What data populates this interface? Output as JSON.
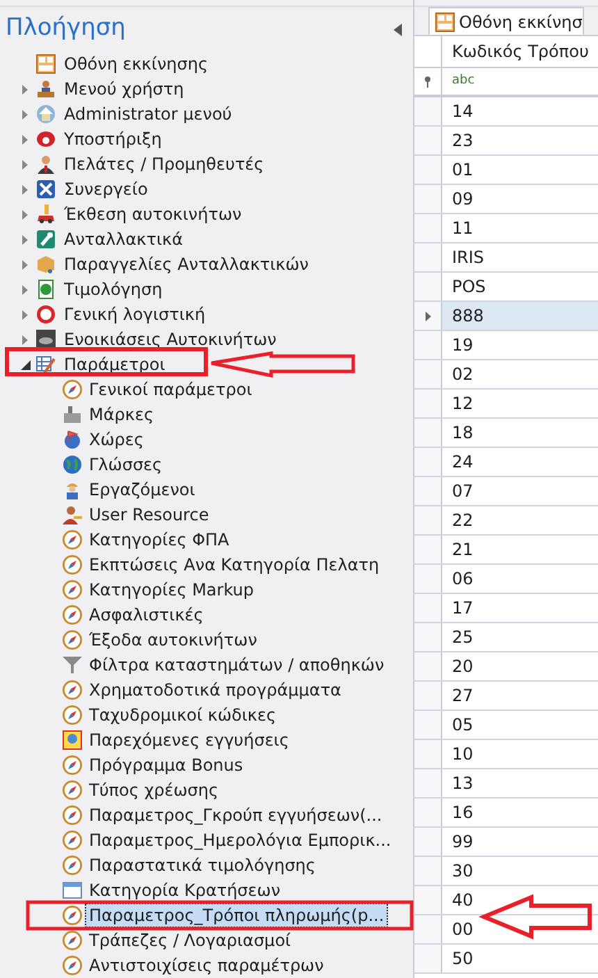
{
  "navigation": {
    "title": "Πλοήγηση",
    "items": [
      {
        "label": "Οθόνη εκκίνησης",
        "expandable": false,
        "selected": false
      },
      {
        "label": "Μενού χρήστη",
        "expandable": true,
        "expanded": false,
        "selected": false
      },
      {
        "label": "Administrator μενού",
        "expandable": true,
        "expanded": false,
        "selected": false
      },
      {
        "label": "Υποστήριξη",
        "expandable": true,
        "expanded": false,
        "selected": false
      },
      {
        "label": "Πελάτες / Προμηθευτές",
        "expandable": true,
        "expanded": false,
        "selected": false
      },
      {
        "label": "Συνεργείο",
        "expandable": true,
        "expanded": false,
        "selected": false
      },
      {
        "label": "Έκθεση αυτοκινήτων",
        "expandable": true,
        "expanded": false,
        "selected": false
      },
      {
        "label": "Ανταλλακτικά",
        "expandable": true,
        "expanded": false,
        "selected": false
      },
      {
        "label": "Παραγγελίες Ανταλλακτικών",
        "expandable": true,
        "expanded": false,
        "selected": false
      },
      {
        "label": "Τιμολόγηση",
        "expandable": true,
        "expanded": false,
        "selected": false
      },
      {
        "label": "Γενική λογιστική",
        "expandable": true,
        "expanded": false,
        "selected": false
      },
      {
        "label": "Ενοικιάσεις Αυτοκινήτων",
        "expandable": true,
        "expanded": false,
        "selected": false
      },
      {
        "label": "Παράμετροι",
        "expandable": true,
        "expanded": true,
        "selected": false,
        "children": [
          {
            "label": "Γενικοί παράμετροι",
            "selected": false
          },
          {
            "label": "Μάρκες",
            "selected": false
          },
          {
            "label": "Χώρες",
            "selected": false
          },
          {
            "label": "Γλώσσες",
            "selected": false
          },
          {
            "label": "Εργαζόμενοι",
            "selected": false
          },
          {
            "label": "User Resource",
            "selected": false
          },
          {
            "label": "Κατηγορίες ΦΠΑ",
            "selected": false
          },
          {
            "label": "Εκπτώσεις Ανα Κατηγορία Πελατη",
            "selected": false
          },
          {
            "label": "Κατηγορίες Markup",
            "selected": false
          },
          {
            "label": "Ασφαλιστικές",
            "selected": false
          },
          {
            "label": "Έξοδα αυτοκινήτων",
            "selected": false
          },
          {
            "label": "Φίλτρα καταστημάτων / αποθηκών",
            "selected": false
          },
          {
            "label": "Χρηματοδοτικά προγράμματα",
            "selected": false
          },
          {
            "label": "Ταχυδρομικοί κώδικες",
            "selected": false
          },
          {
            "label": "Παρεχόμενες εγγυήσεις",
            "selected": false
          },
          {
            "label": "Πρόγραμμα Bonus",
            "selected": false
          },
          {
            "label": "Τύπος χρέωσης",
            "selected": false
          },
          {
            "label": "Παραμετρος_Γκρούπ εγγυήσεων(...",
            "selected": false
          },
          {
            "label": "Παραμετρος_Ημερολόγια Εμπορικ...",
            "selected": false
          },
          {
            "label": "Παραστατικά τιμολόγησης",
            "selected": false
          },
          {
            "label": "Κατηγορία Κρατήσεων",
            "selected": false
          },
          {
            "label": "Παραμετρος_Τρόποι πληρωμής(p...",
            "selected": true
          },
          {
            "label": "Τράπεζες / Λογαριασμοί",
            "selected": false
          },
          {
            "label": "Αντιστοιχίσεις παραμέτρων",
            "selected": false
          }
        ]
      }
    ]
  },
  "document_tab": {
    "label": "Οθόνη εκκίνησ"
  },
  "grid": {
    "columns": [
      "Κωδικός Τρόπου"
    ],
    "filter_placeholder": "abc",
    "rows": [
      {
        "value": "14",
        "selected": false
      },
      {
        "value": "23",
        "selected": false
      },
      {
        "value": "01",
        "selected": false
      },
      {
        "value": "09",
        "selected": false
      },
      {
        "value": "11",
        "selected": false
      },
      {
        "value": "IRIS",
        "selected": false
      },
      {
        "value": "POS",
        "selected": false
      },
      {
        "value": "888",
        "selected": true
      },
      {
        "value": "19",
        "selected": false
      },
      {
        "value": "02",
        "selected": false
      },
      {
        "value": "12",
        "selected": false
      },
      {
        "value": "18",
        "selected": false
      },
      {
        "value": "24",
        "selected": false
      },
      {
        "value": "07",
        "selected": false
      },
      {
        "value": "22",
        "selected": false
      },
      {
        "value": "21",
        "selected": false
      },
      {
        "value": "06",
        "selected": false
      },
      {
        "value": "17",
        "selected": false
      },
      {
        "value": "25",
        "selected": false
      },
      {
        "value": "20",
        "selected": false
      },
      {
        "value": "27",
        "selected": false
      },
      {
        "value": "05",
        "selected": false
      },
      {
        "value": "10",
        "selected": false
      },
      {
        "value": "13",
        "selected": false
      },
      {
        "value": "16",
        "selected": false
      },
      {
        "value": "99",
        "selected": false
      },
      {
        "value": "30",
        "selected": false
      },
      {
        "value": "40",
        "selected": false
      },
      {
        "value": "00",
        "selected": false
      },
      {
        "value": "50",
        "selected": false
      }
    ]
  }
}
